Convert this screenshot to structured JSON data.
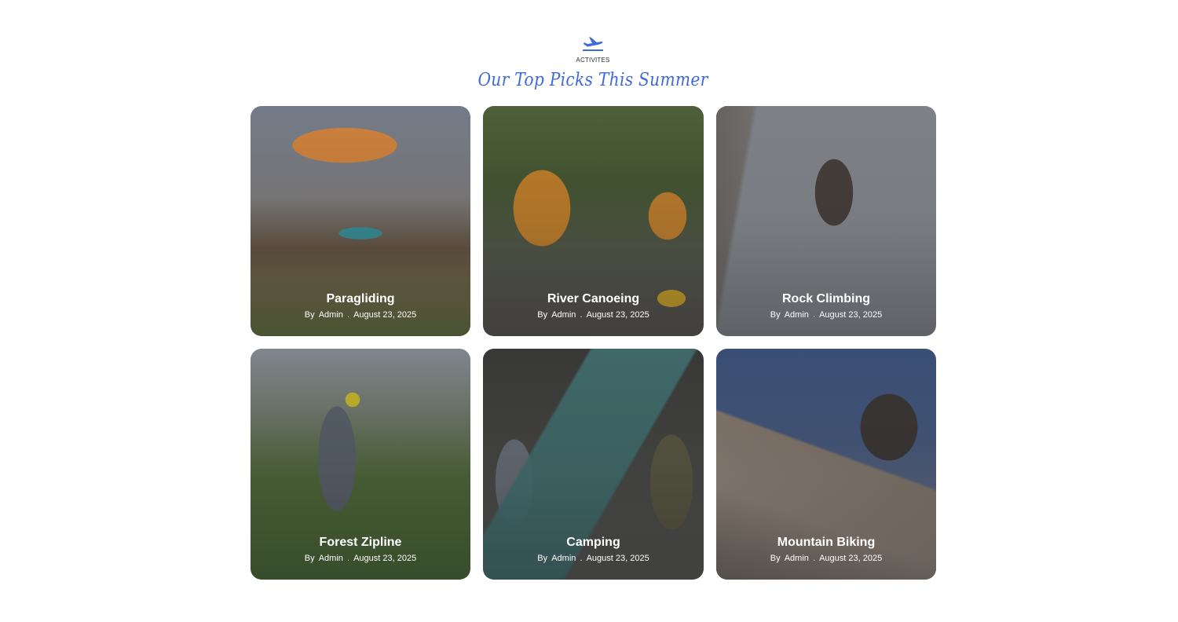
{
  "header": {
    "icon": "airplane-departure-icon",
    "eyebrow": "ACTIVITES",
    "title": "Our Top Picks This Summer",
    "accent_color": "#3f6bd9"
  },
  "cards": [
    {
      "title": "Paragliding",
      "by": "By",
      "author": "Admin",
      "separator": ".",
      "date": "August 23, 2025"
    },
    {
      "title": "River Canoeing",
      "by": "By",
      "author": "Admin",
      "separator": ".",
      "date": "August 23, 2025"
    },
    {
      "title": "Rock Climbing",
      "by": "By",
      "author": "Admin",
      "separator": ".",
      "date": "August 23, 2025"
    },
    {
      "title": "Forest Zipline",
      "by": "By",
      "author": "Admin",
      "separator": ".",
      "date": "August 23, 2025"
    },
    {
      "title": "Camping",
      "by": "By",
      "author": "Admin",
      "separator": ".",
      "date": "August 23, 2025"
    },
    {
      "title": "Mountain Biking",
      "by": "By",
      "author": "Admin",
      "separator": ".",
      "date": "August 23, 2025"
    }
  ]
}
